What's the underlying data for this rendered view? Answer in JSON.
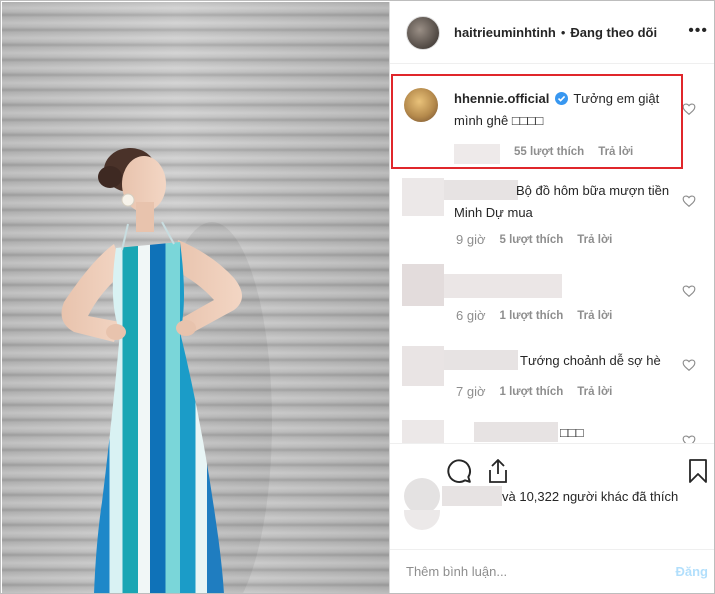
{
  "post": {
    "author": "haitrieuminhtinh",
    "separator": "•",
    "follow_status": "Đang theo dõi",
    "more_icon": "ellipsis-icon"
  },
  "comments": [
    {
      "username": "hhennie.official",
      "verified": true,
      "text": "Tưởng em giật mình ghê",
      "emoji": "□□□□",
      "time": "",
      "likes": "55 lượt thích",
      "reply": "Trả lời",
      "highlighted": true,
      "highlight_color": "#e0262b"
    },
    {
      "username_blurred": true,
      "text": "Bộ đồ hôm bữa mượn tiền Minh Dự mua",
      "time": "9 giờ",
      "likes": "5 lượt thích",
      "reply": "Trả lời"
    },
    {
      "username_blurred": true,
      "text": "",
      "time": "6 giờ",
      "likes": "1 lượt thích",
      "reply": "Trả lời"
    },
    {
      "username_blurred": true,
      "text": "Tướng choảnh dễ sợ hè",
      "time": "7 giờ",
      "likes": "1 lượt thích",
      "reply": "Trả lời"
    },
    {
      "username_blurred": true,
      "text": "□□□",
      "time": "",
      "likes": "",
      "reply": ""
    }
  ],
  "actions": {
    "comment_icon": "comment-bubble-icon",
    "share_icon": "share-icon",
    "save_icon": "bookmark-icon"
  },
  "likes_summary": "và 10,322 người khác đã thích",
  "add_comment": {
    "placeholder": "Thêm bình luận...",
    "post_label": "Đăng"
  },
  "colors": {
    "verified": "#3897f0",
    "muted": "#8e8e8e",
    "post_button_disabled": "#b2dffc"
  }
}
